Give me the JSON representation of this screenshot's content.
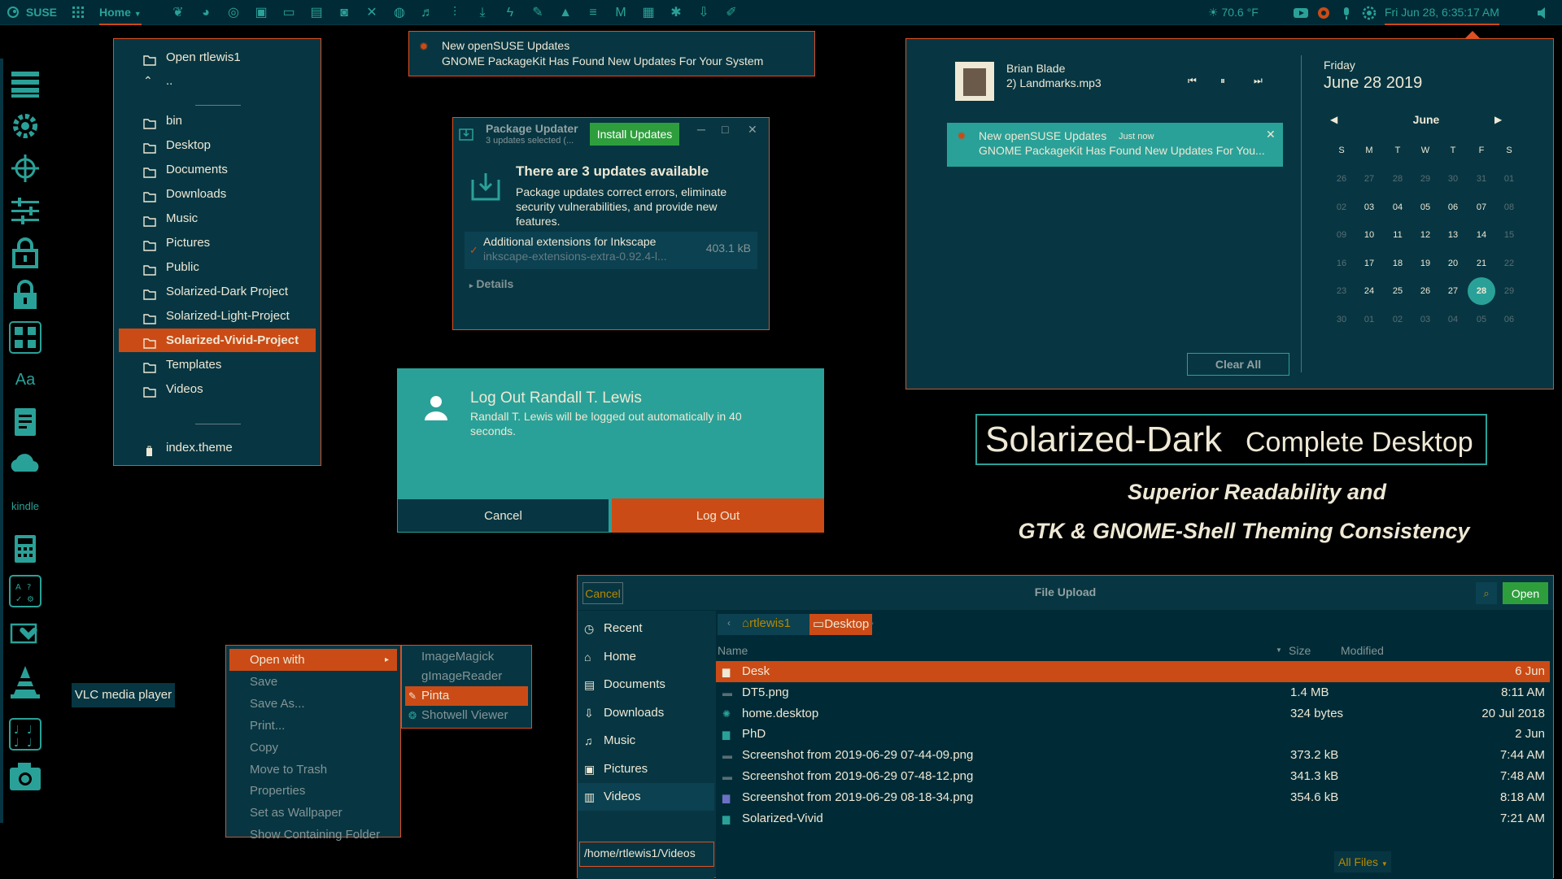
{
  "topbar": {
    "distro": "SUSE",
    "home_menu": "Home",
    "weather": "70.6 °F",
    "clock": "Fri Jun 28,  6:35:17 AM",
    "app_icons": [
      "chameleon-icon",
      "firefox-icon",
      "chrome-icon",
      "monitor-icon",
      "terminal-icon",
      "files-icon",
      "camera-app-icon",
      "x-icon",
      "world-icon",
      "headphones-icon",
      "mixer-icon",
      "download-icon",
      "bolt-icon",
      "feather-icon",
      "inkscape-icon",
      "notes-icon",
      "gmail-icon",
      "outlook-icon",
      "bug-icon",
      "download-arrow-icon",
      "pen-icon"
    ],
    "accent": "#cb4b16"
  },
  "dock": {
    "vlc_tooltip": "VLC media player",
    "icons": [
      "server-icon",
      "settings-gear-icon",
      "crosshair-icon",
      "sliders-icon",
      "lock-icon",
      "lock-alt-icon",
      "apps-grid-icon",
      "font-icon",
      "text-editor-icon",
      "cloud-icon",
      "kindle-icon",
      "calculator-icon",
      "system-monitor-icon",
      "health-icon",
      "vlc-icon",
      "music-notes-icon",
      "camera-icon"
    ],
    "font_label": "Aa",
    "kindle_label": "kindle"
  },
  "file_menu": {
    "open_label": "Open rtlewis1",
    "parent": "..",
    "items": [
      "bin",
      "Desktop",
      "Documents",
      "Downloads",
      "Music",
      "Pictures",
      "Public",
      "Solarized-Dark Project",
      "Solarized-Light-Project",
      "Solarized-Vivid-Project",
      "Templates",
      "Videos"
    ],
    "selected": "Solarized-Vivid-Project",
    "footer_item": "index.theme"
  },
  "notification_top": {
    "title": "New openSUSE Updates",
    "body": "GNOME PackageKit Has Found New Updates For Your System"
  },
  "package_updater": {
    "title": "Package Updater",
    "subtitle": "3 updates selected (...",
    "install_button": "Install Updates",
    "heading": "There are 3 updates available",
    "description": "Package updates correct errors, eliminate security vulnerabilities, and provide new features.",
    "item_name": "Additional extensions for Inkscape",
    "item_pkg": "inkscape-extensions-extra-0.92.4-l...",
    "item_size": "403.1 kB",
    "details": "Details"
  },
  "logout_dialog": {
    "title": "Log Out Randall T. Lewis",
    "message": "Randall T. Lewis will be logged out automatically in 40 seconds.",
    "cancel": "Cancel",
    "confirm": "Log Out"
  },
  "calendar_panel": {
    "media_artist": "Brian Blade",
    "media_track": "2) Landmarks.mp3",
    "notif_title": "New openSUSE Updates",
    "notif_time": "Just now",
    "notif_body": "GNOME PackageKit Has Found New Updates For You...",
    "day_name": "Friday",
    "full_date": "June 28 2019",
    "month": "June",
    "weekdays": [
      "S",
      "M",
      "T",
      "W",
      "T",
      "F",
      "S"
    ],
    "weeks": [
      [
        "26",
        "27",
        "28",
        "29",
        "30",
        "31",
        "01"
      ],
      [
        "02",
        "03",
        "04",
        "05",
        "06",
        "07",
        "08"
      ],
      [
        "09",
        "10",
        "11",
        "12",
        "13",
        "14",
        "15"
      ],
      [
        "16",
        "17",
        "18",
        "19",
        "20",
        "21",
        "22"
      ],
      [
        "23",
        "24",
        "25",
        "26",
        "27",
        "28",
        "29"
      ],
      [
        "30",
        "01",
        "02",
        "03",
        "04",
        "05",
        "06"
      ]
    ],
    "today": "28",
    "clear_all": "Clear All"
  },
  "promo": {
    "title_main": "Solarized-Dark",
    "title_rest": "Complete Desktop",
    "line1": "Superior Readability and",
    "line2": "GTK & GNOME-Shell Theming Consistency"
  },
  "context_menu": {
    "items": [
      "Open with",
      "Save",
      "Save As...",
      "Print...",
      "Copy",
      "Move to Trash",
      "Properties",
      "Set as Wallpaper",
      "Show Containing Folder"
    ],
    "submenu": [
      "ImageMagick",
      "gImageReader",
      "Pinta",
      "Shotwell Viewer"
    ],
    "submenu_selected": "Pinta"
  },
  "file_upload": {
    "cancel": "Cancel",
    "title": "File Upload",
    "open": "Open",
    "path_segments": [
      "rtlewis1",
      "Desktop"
    ],
    "sidebar": [
      "Recent",
      "Home",
      "Documents",
      "Downloads",
      "Music",
      "Pictures",
      "Videos"
    ],
    "sidebar_selected": "Videos",
    "location": "/home/rtlewis1/Videos",
    "columns": [
      "Name",
      "Size",
      "Modified"
    ],
    "rows": [
      {
        "name": "Desk",
        "size": "",
        "modified": "6 Jun",
        "kind": "folder"
      },
      {
        "name": "DT5.png",
        "size": "1.4 MB",
        "modified": "8:11 AM",
        "kind": "image"
      },
      {
        "name": "home.desktop",
        "size": "324 bytes",
        "modified": "20 Jul 2018",
        "kind": "desktop"
      },
      {
        "name": "PhD",
        "size": "",
        "modified": "2 Jun",
        "kind": "folder"
      },
      {
        "name": "Screenshot from 2019-06-29 07-44-09.png",
        "size": "373.2 kB",
        "modified": "7:44 AM",
        "kind": "image"
      },
      {
        "name": "Screenshot from 2019-06-29 07-48-12.png",
        "size": "341.3 kB",
        "modified": "7:48 AM",
        "kind": "image"
      },
      {
        "name": "Screenshot from 2019-06-29 08-18-34.png",
        "size": "354.6 kB",
        "modified": "8:18 AM",
        "kind": "image-purple"
      },
      {
        "name": "Solarized-Vivid",
        "size": "",
        "modified": "7:21 AM",
        "kind": "folder"
      }
    ],
    "filter": "All Files"
  }
}
